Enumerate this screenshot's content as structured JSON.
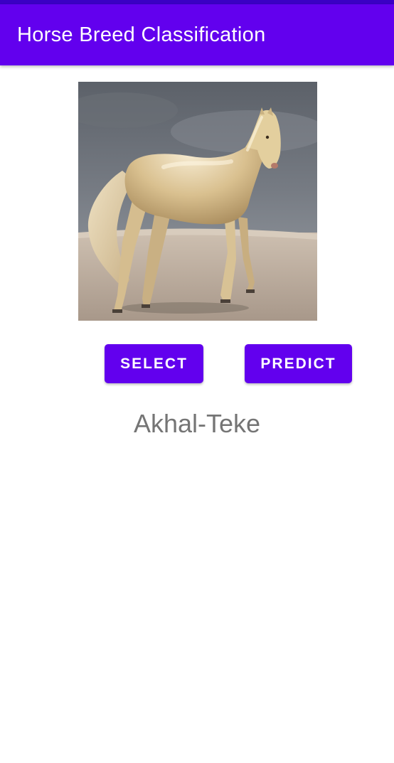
{
  "app_bar": {
    "title": "Horse Breed Classification"
  },
  "image_view": {
    "icon": "horse-photo"
  },
  "buttons": {
    "select_label": "SELECT",
    "predict_label": "PREDICT"
  },
  "result": {
    "label": "Akhal-Teke"
  },
  "colors": {
    "primary": "#6200ee",
    "primary_dark": "#3a00c4",
    "result_text": "#757575"
  }
}
